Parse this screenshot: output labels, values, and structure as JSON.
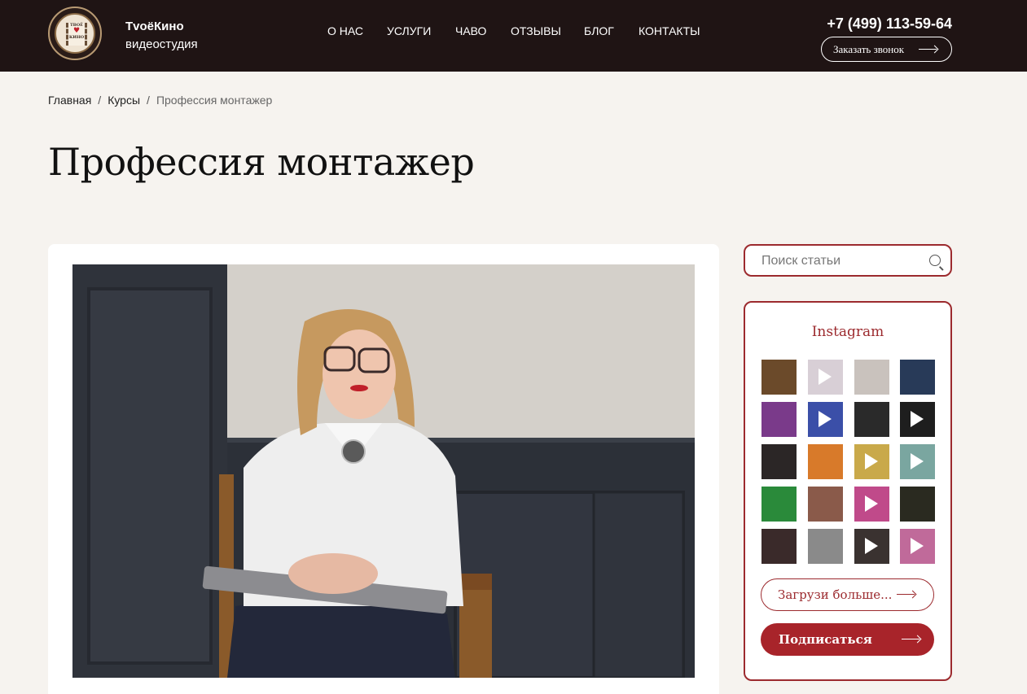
{
  "header": {
    "brand_name": "TvoёКино",
    "brand_sub": "видеостудия",
    "logo_text_top": "ТВОЁ",
    "logo_text_bottom": "КИНО",
    "nav": [
      {
        "label": "О НАС"
      },
      {
        "label": "УСЛУГИ"
      },
      {
        "label": "ЧАВО"
      },
      {
        "label": "ОТЗЫВЫ"
      },
      {
        "label": "БЛОГ"
      },
      {
        "label": "КОНТАКТЫ"
      }
    ],
    "phone": "+7 (499) 113-59-64",
    "call_label": "Заказать звонок"
  },
  "breadcrumb": {
    "home": "Главная",
    "sep": "/",
    "section": "Курсы",
    "current": "Профессия монтажер"
  },
  "page_title": "Профессия монтажер",
  "sidebar": {
    "search_placeholder": "Поиск статьи",
    "instagram_title": "Instagram",
    "thumbs": [
      {
        "color": "#6b4a2a",
        "video": false
      },
      {
        "color": "#d8cfd6",
        "video": true
      },
      {
        "color": "#c9c2bd",
        "video": false
      },
      {
        "color": "#283a58",
        "video": false
      },
      {
        "color": "#7a3a8a",
        "video": false
      },
      {
        "color": "#3b4fa8",
        "video": true
      },
      {
        "color": "#2a2a2a",
        "video": false
      },
      {
        "color": "#1e1e1e",
        "video": true
      },
      {
        "color": "#2b2626",
        "video": false
      },
      {
        "color": "#d87a2a",
        "video": false
      },
      {
        "color": "#c9a94a",
        "video": true
      },
      {
        "color": "#7aa6a0",
        "video": true
      },
      {
        "color": "#2a8a3a",
        "video": false
      },
      {
        "color": "#8a5a4a",
        "video": false
      },
      {
        "color": "#c04a8a",
        "video": true
      },
      {
        "color": "#2a2a20",
        "video": false
      },
      {
        "color": "#3a2a2a",
        "video": false
      },
      {
        "color": "#8a8a8a",
        "video": false
      },
      {
        "color": "#3a3230",
        "video": true
      },
      {
        "color": "#c06a9a",
        "video": true
      }
    ],
    "load_more": "Загрузи больше...",
    "subscribe": "Подписаться"
  },
  "colors": {
    "header_bg": "#1f1414",
    "accent": "#9c2a2e",
    "page_bg": "#f6f3ef"
  }
}
